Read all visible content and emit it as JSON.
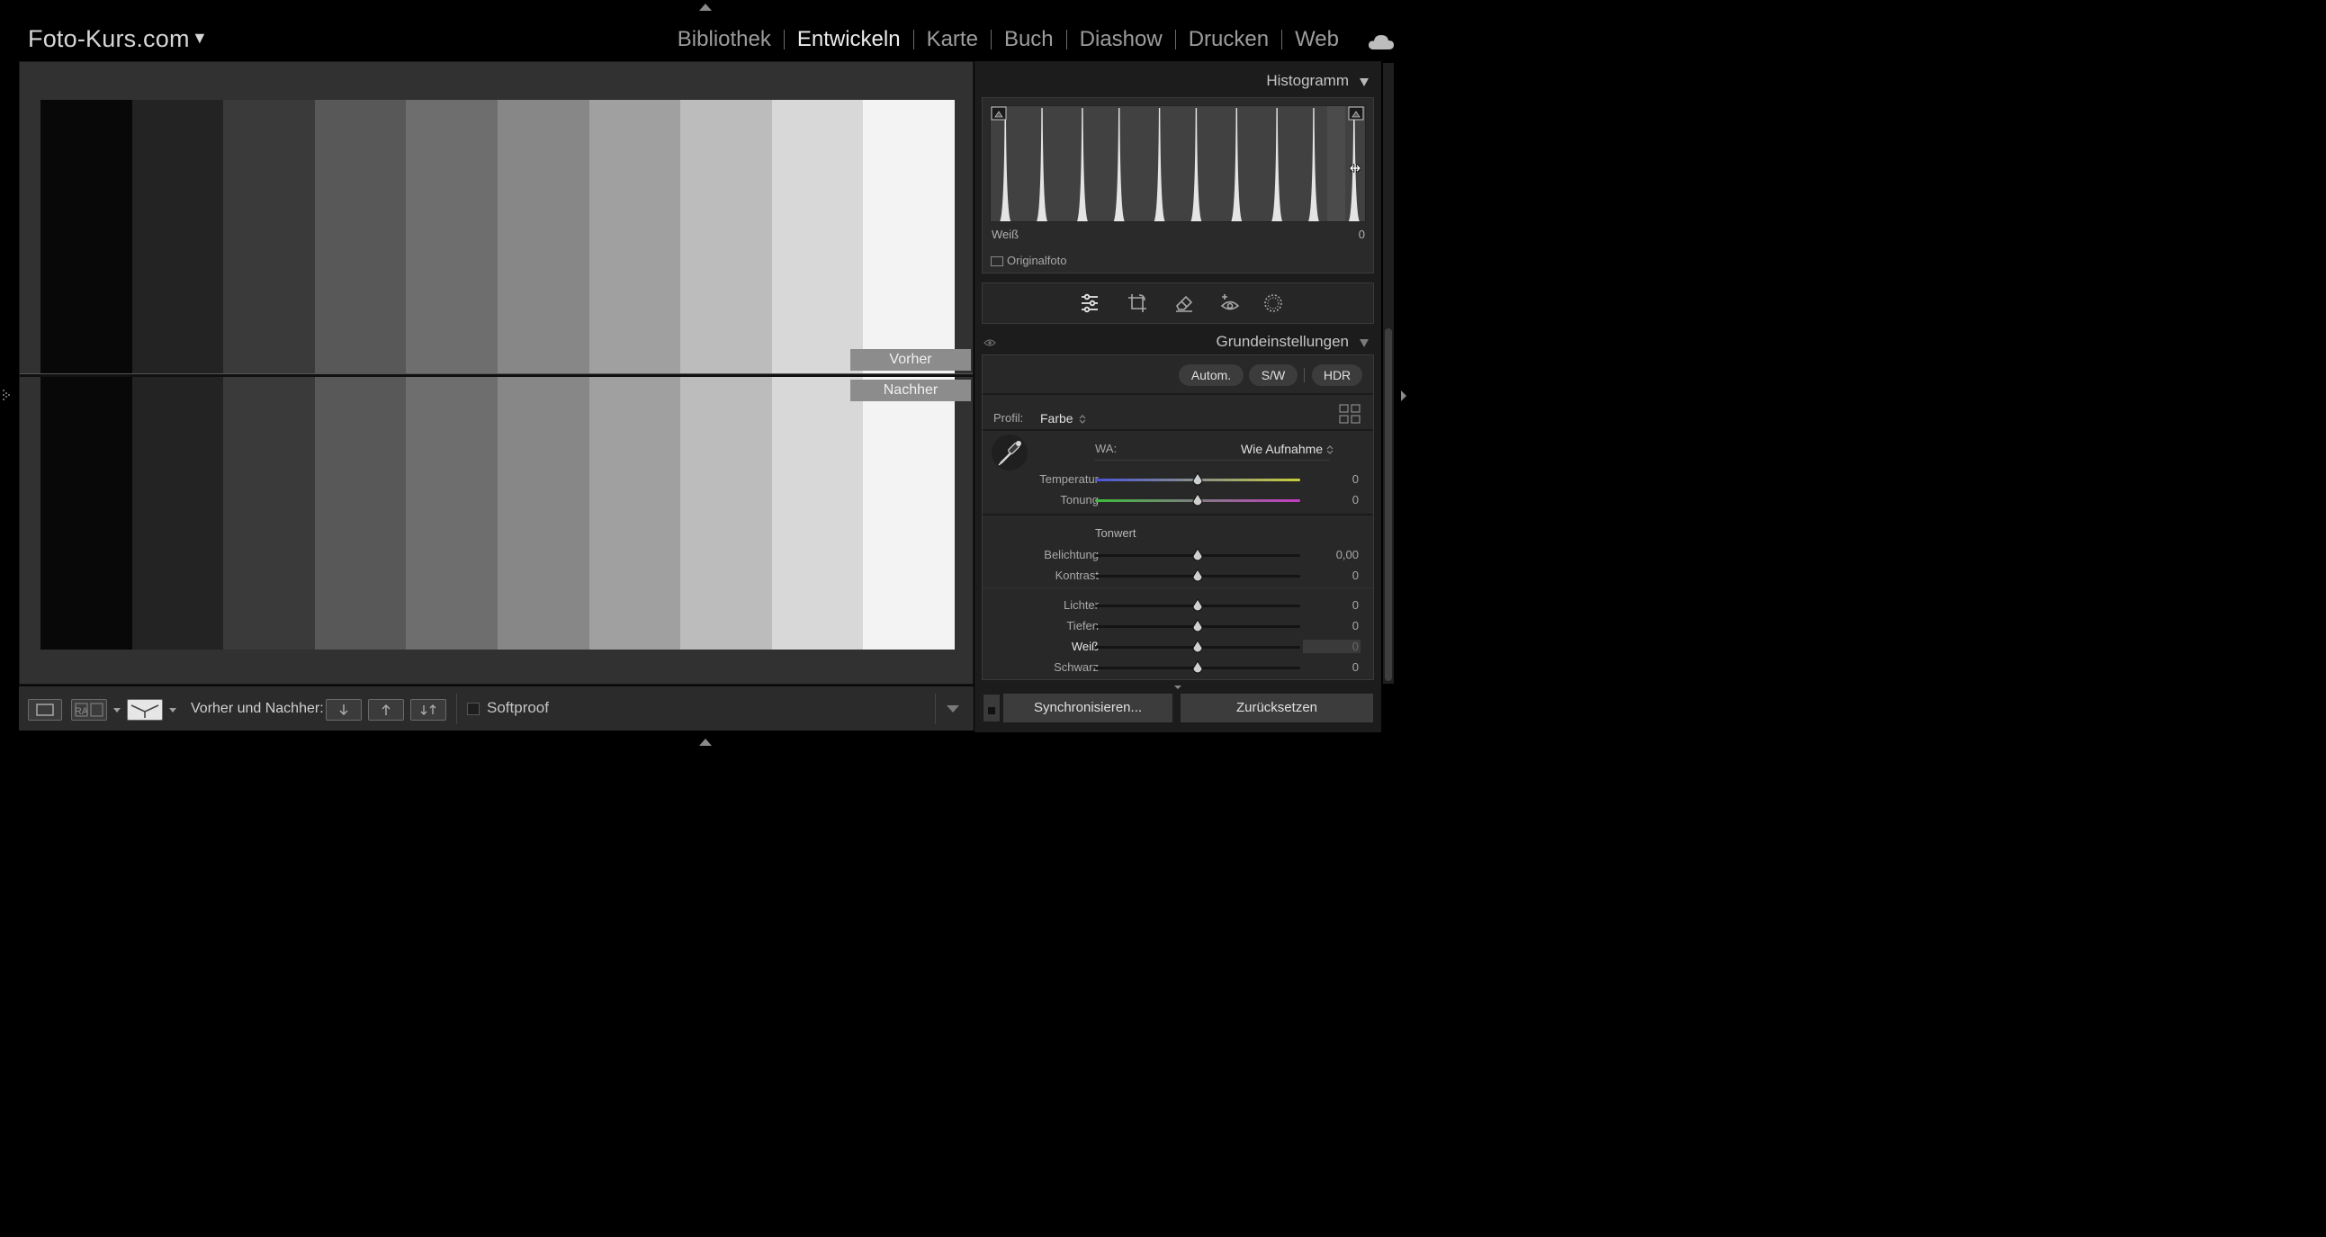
{
  "app": {
    "catalog_name": "Foto-Kurs.com",
    "catalog_caret": "▼",
    "modules": [
      {
        "label": "Bibliothek",
        "active": false
      },
      {
        "label": "Entwickeln",
        "active": true
      },
      {
        "label": "Karte",
        "active": false
      },
      {
        "label": "Buch",
        "active": false
      },
      {
        "label": "Diashow",
        "active": false
      },
      {
        "label": "Drucken",
        "active": false
      },
      {
        "label": "Web",
        "active": false
      }
    ],
    "cloud_icon": "cloud-icon"
  },
  "image": {
    "before_label": "Vorher",
    "after_label": "Nachher",
    "strip_colors": [
      "#080808",
      "#232323",
      "#3a3a3a",
      "#585858",
      "#6e6e6e",
      "#878787",
      "#a0a0a0",
      "#bcbcbc",
      "#d8d8d8",
      "#f3f3f3"
    ]
  },
  "toolbar": {
    "before_after_label": "Vorher und Nachher:",
    "ra_label": "RA",
    "softproof_label": "Softproof",
    "softproof_checked": false
  },
  "histogram": {
    "title": "Histogramm",
    "info_label": "Weiß",
    "info_value": "0",
    "original_label": "Originalfoto",
    "original_checked": false,
    "peak_positions": [
      0.03,
      0.13,
      0.24,
      0.34,
      0.45,
      0.55,
      0.66,
      0.77,
      0.87,
      0.98
    ]
  },
  "tools": [
    "develop-sliders-icon",
    "crop-icon",
    "healing-eraser-icon",
    "red-eye-icon",
    "masking-icon"
  ],
  "basic": {
    "title": "Grundeinstellungen",
    "buttons": {
      "auto": "Autom.",
      "bw": "S/W",
      "hdr": "HDR"
    },
    "profile_label": "Profil:",
    "profile_value": "Farbe",
    "wb_label": "WA:",
    "wb_value": "Wie Aufnahme",
    "tone_heading": "Tonwert",
    "sliders": [
      {
        "label": "Temperatur",
        "value": "0",
        "position": 0.5
      },
      {
        "label": "Tonung",
        "value": "0",
        "position": 0.5
      },
      {
        "label": "Belichtung",
        "value": "0,00",
        "position": 0.5
      },
      {
        "label": "Kontrast",
        "value": "0",
        "position": 0.5
      },
      {
        "label": "Lichter",
        "value": "0",
        "position": 0.5
      },
      {
        "label": "Tiefen",
        "value": "0",
        "position": 0.5
      },
      {
        "label": "Weiß",
        "value": "0",
        "position": 0.5
      },
      {
        "label": "Schwarz",
        "value": "0",
        "position": 0.5
      }
    ]
  },
  "footer": {
    "sync_label": "Synchronisieren...",
    "reset_label": "Zurücksetzen"
  },
  "colors": {
    "temp_gradient": [
      "#4a54d8",
      "#c8cd3a"
    ],
    "tint_gradient": [
      "#3dbb3d",
      "#c43cc4"
    ]
  }
}
